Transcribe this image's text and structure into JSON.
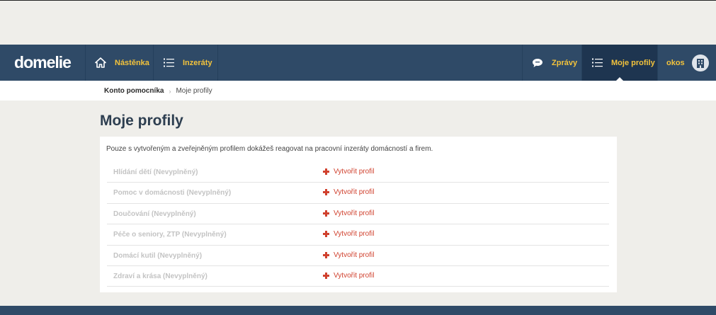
{
  "brand": {
    "logo_text": "domelie"
  },
  "nav": {
    "left": [
      {
        "label": "Nástěnka",
        "icon": "home-icon"
      },
      {
        "label": "Inzeráty",
        "icon": "list-icon"
      }
    ],
    "right": [
      {
        "label": "Zprávy",
        "icon": "chat-icon"
      },
      {
        "label": "Moje profily",
        "icon": "list-icon",
        "active": true
      },
      {
        "label": "okos",
        "icon": "building-avatar-icon"
      }
    ]
  },
  "breadcrumb": {
    "root": "Konto pomocníka",
    "separator": "›",
    "current": "Moje profily"
  },
  "page": {
    "title": "Moje profily",
    "intro": "Pouze s vytvořeným a zveřejněným profilem dokážeš reagovat na pracovní inzeráty domácností a firem."
  },
  "profiles": [
    {
      "name": "Hlídání dětí (Nevyplněný)",
      "action": "Vytvořit profil"
    },
    {
      "name": "Pomoc v domácnosti (Nevyplněný)",
      "action": "Vytvořit profil"
    },
    {
      "name": "Doučování (Nevyplněný)",
      "action": "Vytvořit profil"
    },
    {
      "name": "Péče o seniory, ZTP (Nevyplněný)",
      "action": "Vytvořit profil"
    },
    {
      "name": "Domácí kutil (Nevyplněný)",
      "action": "Vytvořit profil"
    },
    {
      "name": "Zdraví a krása (Nevyplněný)",
      "action": "Vytvořit profil"
    }
  ],
  "colors": {
    "navbar": "#2f4a67",
    "nav_active": "#1e3550",
    "accent_yellow": "#f3c33c",
    "action_red": "#d0412e",
    "page_bg": "#efeeea"
  }
}
